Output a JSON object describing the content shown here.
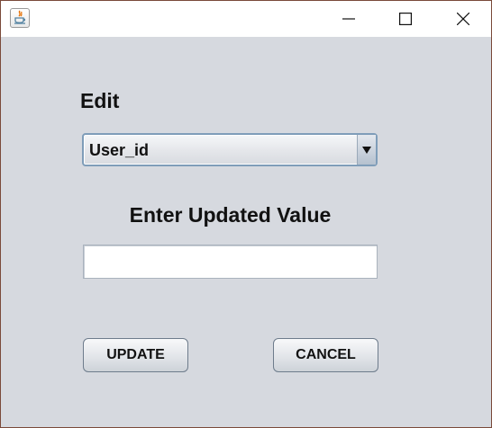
{
  "window": {
    "icon": "java-cup-icon",
    "controls": [
      "minimize-icon",
      "maximize-icon",
      "close-icon"
    ]
  },
  "form": {
    "edit_label": "Edit",
    "field_select": {
      "selected": "User_id"
    },
    "value_label": "Enter Updated Value",
    "value_input": {
      "value": "",
      "placeholder": ""
    },
    "update_label": "UPDATE",
    "cancel_label": "CANCEL"
  },
  "colors": {
    "background": "#d6d9df",
    "titlebar": "#ffffff",
    "combo_border": "#7f9db9"
  }
}
